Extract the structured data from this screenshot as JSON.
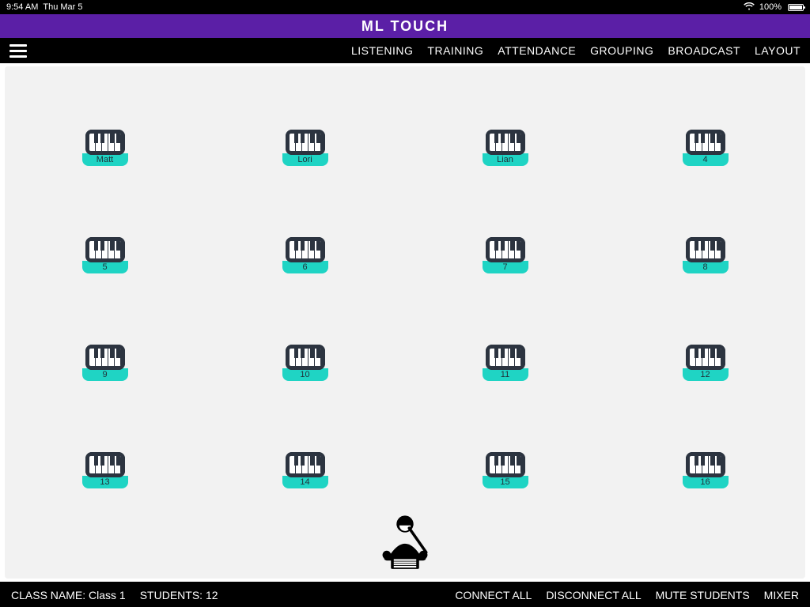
{
  "statusbar": {
    "time": "9:54 AM",
    "date": "Thu Mar 5",
    "battery_pct": "100%"
  },
  "app": {
    "title": "ML TOUCH"
  },
  "nav": {
    "listening": "LISTENING",
    "training": "TRAINING",
    "attendance": "ATTENDANCE",
    "grouping": "GROUPING",
    "broadcast": "BROADCAST",
    "layout": "LAYOUT"
  },
  "stations": [
    {
      "label": "Matt"
    },
    {
      "label": "Lori"
    },
    {
      "label": "Lian"
    },
    {
      "label": "4"
    },
    {
      "label": "5"
    },
    {
      "label": "6"
    },
    {
      "label": "7"
    },
    {
      "label": "8"
    },
    {
      "label": "9"
    },
    {
      "label": "10"
    },
    {
      "label": "11"
    },
    {
      "label": "12"
    },
    {
      "label": "13"
    },
    {
      "label": "14"
    },
    {
      "label": "15"
    },
    {
      "label": "16"
    }
  ],
  "footer": {
    "class_name_label": "CLASS NAME:",
    "class_name_value": "Class 1",
    "students_label": "STUDENTS:",
    "students_value": "12",
    "connect_all": "CONNECT ALL",
    "disconnect_all": "DISCONNECT ALL",
    "mute_students": "MUTE STUDENTS",
    "mixer": "MIXER"
  },
  "icons": {
    "menu": "menu-icon",
    "wifi": "wifi-icon",
    "battery": "battery-icon",
    "piano": "piano-icon",
    "teacher": "conductor-icon"
  }
}
